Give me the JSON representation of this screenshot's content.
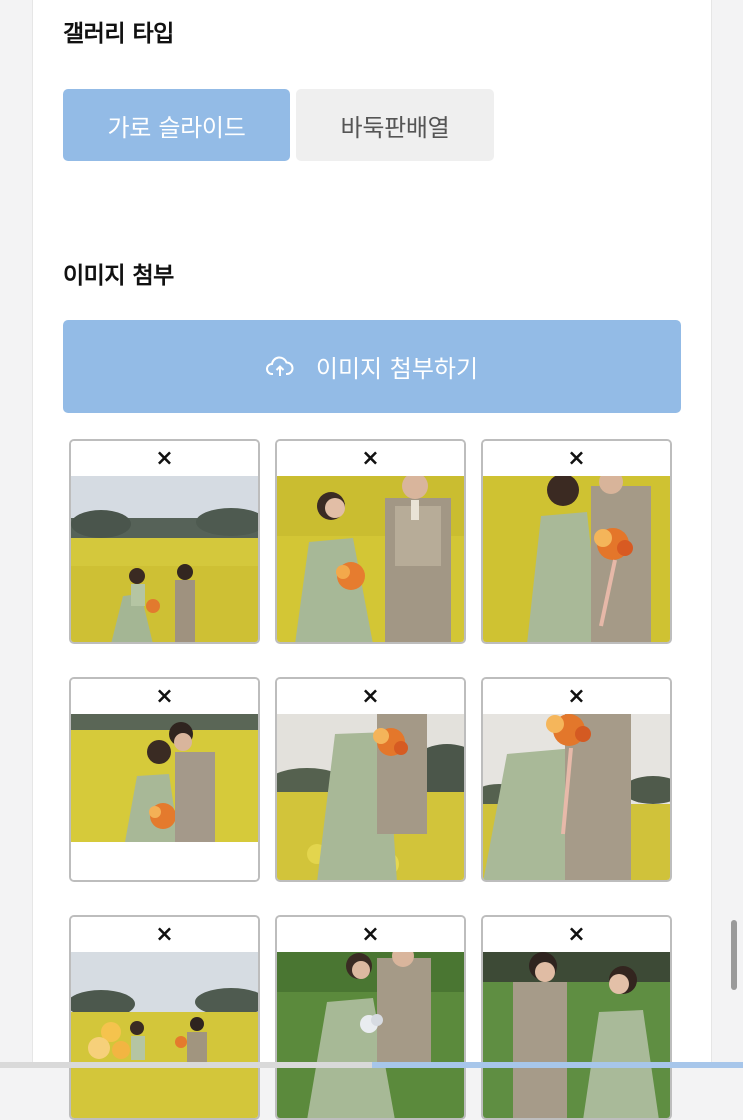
{
  "gallery_type": {
    "title": "갤러리 타입",
    "options": [
      {
        "label": "가로 슬라이드",
        "selected": true
      },
      {
        "label": "바둑판배열",
        "selected": false
      }
    ]
  },
  "image_attach": {
    "title": "이미지 첨부",
    "button_label": "이미지 첨부하기",
    "button_icon": "cloud-upload-icon"
  },
  "thumbnails": [
    {
      "remove_label": "×"
    },
    {
      "remove_label": "×"
    },
    {
      "remove_label": "×"
    },
    {
      "remove_label": "×"
    },
    {
      "remove_label": "×"
    },
    {
      "remove_label": "×"
    },
    {
      "remove_label": "×"
    },
    {
      "remove_label": "×"
    },
    {
      "remove_label": "×"
    }
  ],
  "colors": {
    "accent": "#93bbe6",
    "inactive_bg": "#efefef"
  }
}
